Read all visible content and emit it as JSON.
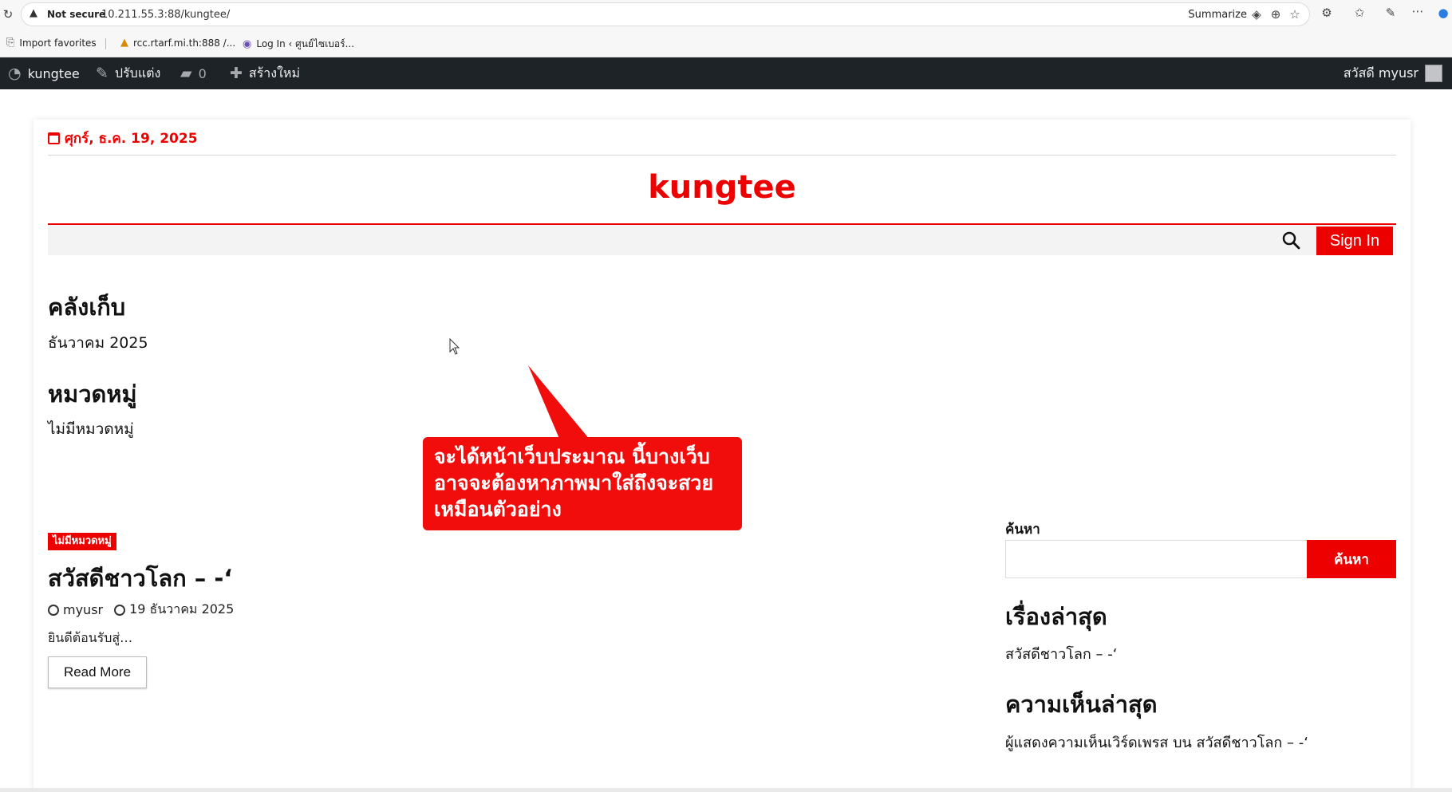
{
  "browser": {
    "security_label": "Not secure",
    "url": "10.211.55.3:88/kungtee/",
    "summarize_label": "Summarize",
    "favorites": [
      {
        "label": "Import favorites",
        "icon": "import-icon"
      },
      {
        "label": "rcc.rtarf.mi.th:888 /...",
        "icon": "site-icon"
      },
      {
        "label": "Log In ‹ ศูนย์ไซเบอร์...",
        "icon": "shield-icon"
      }
    ]
  },
  "adminbar": {
    "site_name": "kungtee",
    "customize": "ปรับแต่ง",
    "comments_count": "0",
    "new_label": "สร้างใหม่",
    "greeting": "สวัสดี myusr"
  },
  "site": {
    "date": "ศุกร์, ธ.ค. 19, 2025",
    "title": "kungtee",
    "signin_label": "Sign In"
  },
  "widgets": {
    "archives_title": "คลังเก็บ",
    "archives_item": "ธันวาคม 2025",
    "categories_title": "หมวดหมู่",
    "categories_item": "ไม่มีหมวดหมู่"
  },
  "post": {
    "category": "ไม่มีหมวดหมู่",
    "title": "สวัสดีชาวโลก – -‘",
    "author": "myusr",
    "date": "19 ธันวาคม 2025",
    "excerpt": "ยินดีต้อนรับสู่…",
    "read_more": "Read More"
  },
  "sidebar": {
    "search_label": "ค้นหา",
    "search_button": "ค้นหา",
    "recent_posts_title": "เรื่องล่าสุด",
    "recent_post": "สวัสดีชาวโลก – -‘",
    "recent_comments_title": "ความเห็นล่าสุด",
    "recent_comment": "ผู้แสดงความเห็นเวิร์ดเพรส บน สวัสดีชาวโลก – -‘"
  },
  "callout": {
    "lines": [
      "จะได้หน้าเว็บประมาณ นี้บางเว็บ",
      "อาจจะต้องหาภาพมาใส่ถึงจะสวย",
      "เหมือนตัวอย่าง"
    ]
  },
  "colors": {
    "accent": "#ec0000",
    "adminbar": "#1d2327"
  }
}
